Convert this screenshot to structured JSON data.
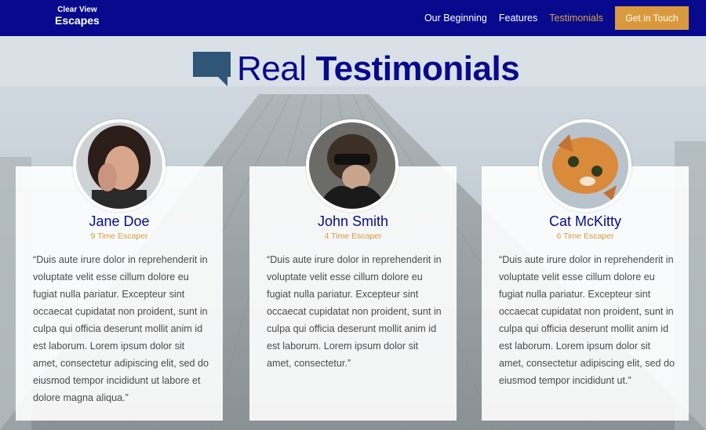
{
  "brand": {
    "line1": "Clear View",
    "line2": "Escapes"
  },
  "nav": {
    "items": [
      {
        "label": "Our Beginning",
        "active": false
      },
      {
        "label": "Features",
        "active": false
      },
      {
        "label": "Testimonials",
        "active": true
      }
    ],
    "cta_label": "Get in Touch"
  },
  "heading": {
    "light": "Real",
    "bold": "Testimonials"
  },
  "testimonials": [
    {
      "name": "Jane Doe",
      "subtitle": "9 Time Escaper",
      "quote": "“Duis aute irure dolor in reprehenderit in voluptate velit esse cillum dolore eu fugiat nulla pariatur. Excepteur sint occaecat cupidatat non proident, sunt in culpa qui officia deserunt mollit anim id est laborum. Lorem ipsum dolor sit amet, consectetur adipiscing elit, sed do eiusmod tempor incididunt ut labore et dolore magna aliqua.”"
    },
    {
      "name": "John Smith",
      "subtitle": "4 Time Escaper",
      "quote": "“Duis aute irure dolor in reprehenderit in voluptate velit esse cillum dolore eu fugiat nulla pariatur. Excepteur sint occaecat cupidatat non proident, sunt in culpa qui officia deserunt mollit anim id est laborum. Lorem ipsum dolor sit amet, consectetur.”"
    },
    {
      "name": "Cat McKitty",
      "subtitle": "6 Time Escaper",
      "quote": "“Duis aute irure dolor in reprehenderit in voluptate velit esse cillum dolore eu fugiat nulla pariatur. Excepteur sint occaecat cupidatat non proident, sunt in culpa qui officia deserunt mollit anim id est laborum. Lorem ipsum dolor sit amet, consectetur adipiscing elit, sed do eiusmod tempor incididunt ut.”"
    }
  ],
  "colors": {
    "navbar": "#070a8c",
    "accent": "#d99a3e",
    "heading": "#070a8c",
    "icon": "#2f5677"
  },
  "icons": {
    "heading": "speech-bubble-icon"
  }
}
